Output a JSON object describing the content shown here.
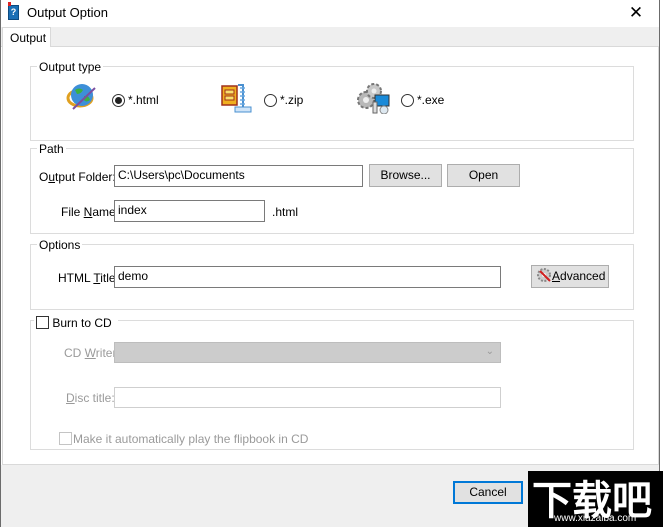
{
  "window": {
    "title": "Output Option",
    "close_glyph": "✕",
    "app_icon_glyph": "?"
  },
  "tabs": [
    {
      "label": "Output",
      "active": true
    }
  ],
  "output_type": {
    "group_label": "Output type",
    "options": [
      {
        "label": "*.html",
        "icon": "globe-icon",
        "selected": true
      },
      {
        "label": "*.zip",
        "icon": "archive-icon",
        "selected": false
      },
      {
        "label": "*.exe",
        "icon": "gears-computer-icon",
        "selected": false
      }
    ]
  },
  "path": {
    "group_label": "Path",
    "output_folder_label_pre": "O",
    "output_folder_label_mnemonic": "u",
    "output_folder_label_post": "tput Folder:",
    "output_folder_value": "C:\\Users\\pc\\Documents",
    "browse_label": "Browse...",
    "open_label": "Open",
    "file_name_label_pre": "File ",
    "file_name_label_mnemonic": "N",
    "file_name_label_post": "ame:",
    "file_name_value": "index",
    "file_ext": ".html"
  },
  "options": {
    "group_label": "Options",
    "html_title_label_pre": "HTML ",
    "html_title_label_mnemonic": "T",
    "html_title_label_post": "itle:",
    "html_title_value": "demo",
    "advanced_mnemonic": "A",
    "advanced_rest": "dvanced"
  },
  "burn": {
    "checkbox_label": "Burn to CD",
    "checked": false,
    "cd_writer_label_pre": "CD ",
    "cd_writer_label_mnemonic": "W",
    "cd_writer_label_post": "riter",
    "cd_writer_value": "",
    "disc_title_label_mnemonic": "D",
    "disc_title_label_post": "isc title:",
    "disc_title_value": "",
    "autoplay_label": "Make it automatically play the flipbook in CD",
    "autoplay_checked": false
  },
  "footer": {
    "cancel_label": "Cancel"
  },
  "watermark": {
    "big_text": "下载吧",
    "url_text": "www.xiazaiba.com"
  }
}
